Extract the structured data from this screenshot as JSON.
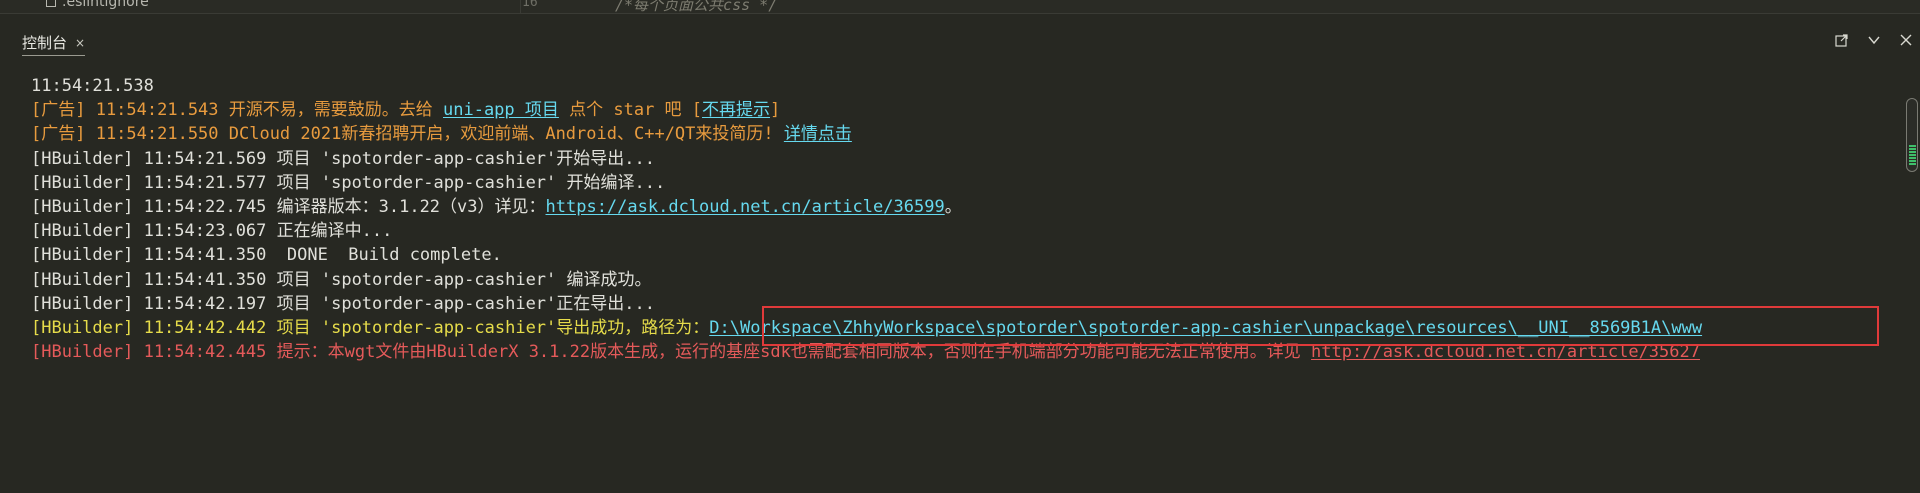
{
  "editor_peek": {
    "file_name": ".eslintignore",
    "line_number": "16",
    "code": "/*每个页面公共css */"
  },
  "panel": {
    "tab_label": "控制台",
    "close_glyph": "×"
  },
  "toolbar": {
    "icons": [
      "export-window-icon",
      "chevron-down-icon",
      "close-panel-icon"
    ]
  },
  "console": {
    "lines": [
      {
        "segments": [
          {
            "text": "11:54:21.538",
            "color": "white"
          }
        ]
      },
      {
        "segments": [
          {
            "text": "[广告] 11:54:21.543 开源不易，需要鼓励。去给 ",
            "color": "ad"
          },
          {
            "text": "uni-app 项目",
            "color": "link"
          },
          {
            "text": " 点个 star 吧 [",
            "color": "ad"
          },
          {
            "text": "不再提示",
            "color": "link"
          },
          {
            "text": "]",
            "color": "ad"
          }
        ]
      },
      {
        "segments": [
          {
            "text": "[广告] 11:54:21.550 DCloud 2021新春招聘开启，欢迎前端、Android、C++/QT来投简历! ",
            "color": "ad"
          },
          {
            "text": "详情点击",
            "color": "link"
          }
        ]
      },
      {
        "segments": [
          {
            "text": "[HBuilder] 11:54:21.569 项目 'spotorder-app-cashier'开始导出...",
            "color": "white"
          }
        ]
      },
      {
        "segments": [
          {
            "text": "[HBuilder] 11:54:21.577 项目 'spotorder-app-cashier' 开始编译...",
            "color": "white"
          }
        ]
      },
      {
        "segments": [
          {
            "text": "[HBuilder] 11:54:22.745 编译器版本：3.1.22（v3）详见：",
            "color": "white"
          },
          {
            "text": "https://ask.dcloud.net.cn/article/36599",
            "color": "link"
          },
          {
            "text": "。",
            "color": "white"
          }
        ]
      },
      {
        "segments": [
          {
            "text": "[HBuilder] 11:54:23.067 正在编译中...",
            "color": "white"
          }
        ]
      },
      {
        "segments": [
          {
            "text": "[HBuilder] 11:54:41.350  DONE  Build complete.",
            "color": "white"
          }
        ]
      },
      {
        "segments": [
          {
            "text": "[HBuilder] 11:54:41.350 项目 'spotorder-app-cashier' 编译成功。",
            "color": "white"
          }
        ]
      },
      {
        "segments": [
          {
            "text": "[HBuilder] 11:54:42.197 项目 'spotorder-app-cashier'正在导出...",
            "color": "white"
          }
        ]
      },
      {
        "segments": [
          {
            "text": "[HBuilder] 11:54:42.442 项目 'spotorder-app-cashier'导出成功，路径为：",
            "color": "yellow"
          },
          {
            "text": "D:\\Workspace\\ZhhyWorkspace\\spotorder\\spotorder-app-cashier\\unpackage\\resources\\__UNI__8569B1A\\www",
            "color": "link"
          }
        ]
      },
      {
        "segments": [
          {
            "text": "[HBuilder] 11:54:42.445 提示：本wgt文件由HBuilderX 3.1.22版本生成，运行的基座sdk也需配套相同版本，否则在手机端部分功能可能无法正常使用。详见 ",
            "color": "red"
          },
          {
            "text": "http://ask.dcloud.net.cn/article/35627",
            "color": "link-red"
          }
        ]
      }
    ]
  },
  "colors": {
    "background": "#272822",
    "white": "#e0e0da",
    "ad": "#e89b3e",
    "yellow": "#e6dc4a",
    "red": "#e55a5a",
    "link": "#66d9ef",
    "highlight_box": "#e03a3a",
    "scroll_marks": "#3fbf6a"
  }
}
